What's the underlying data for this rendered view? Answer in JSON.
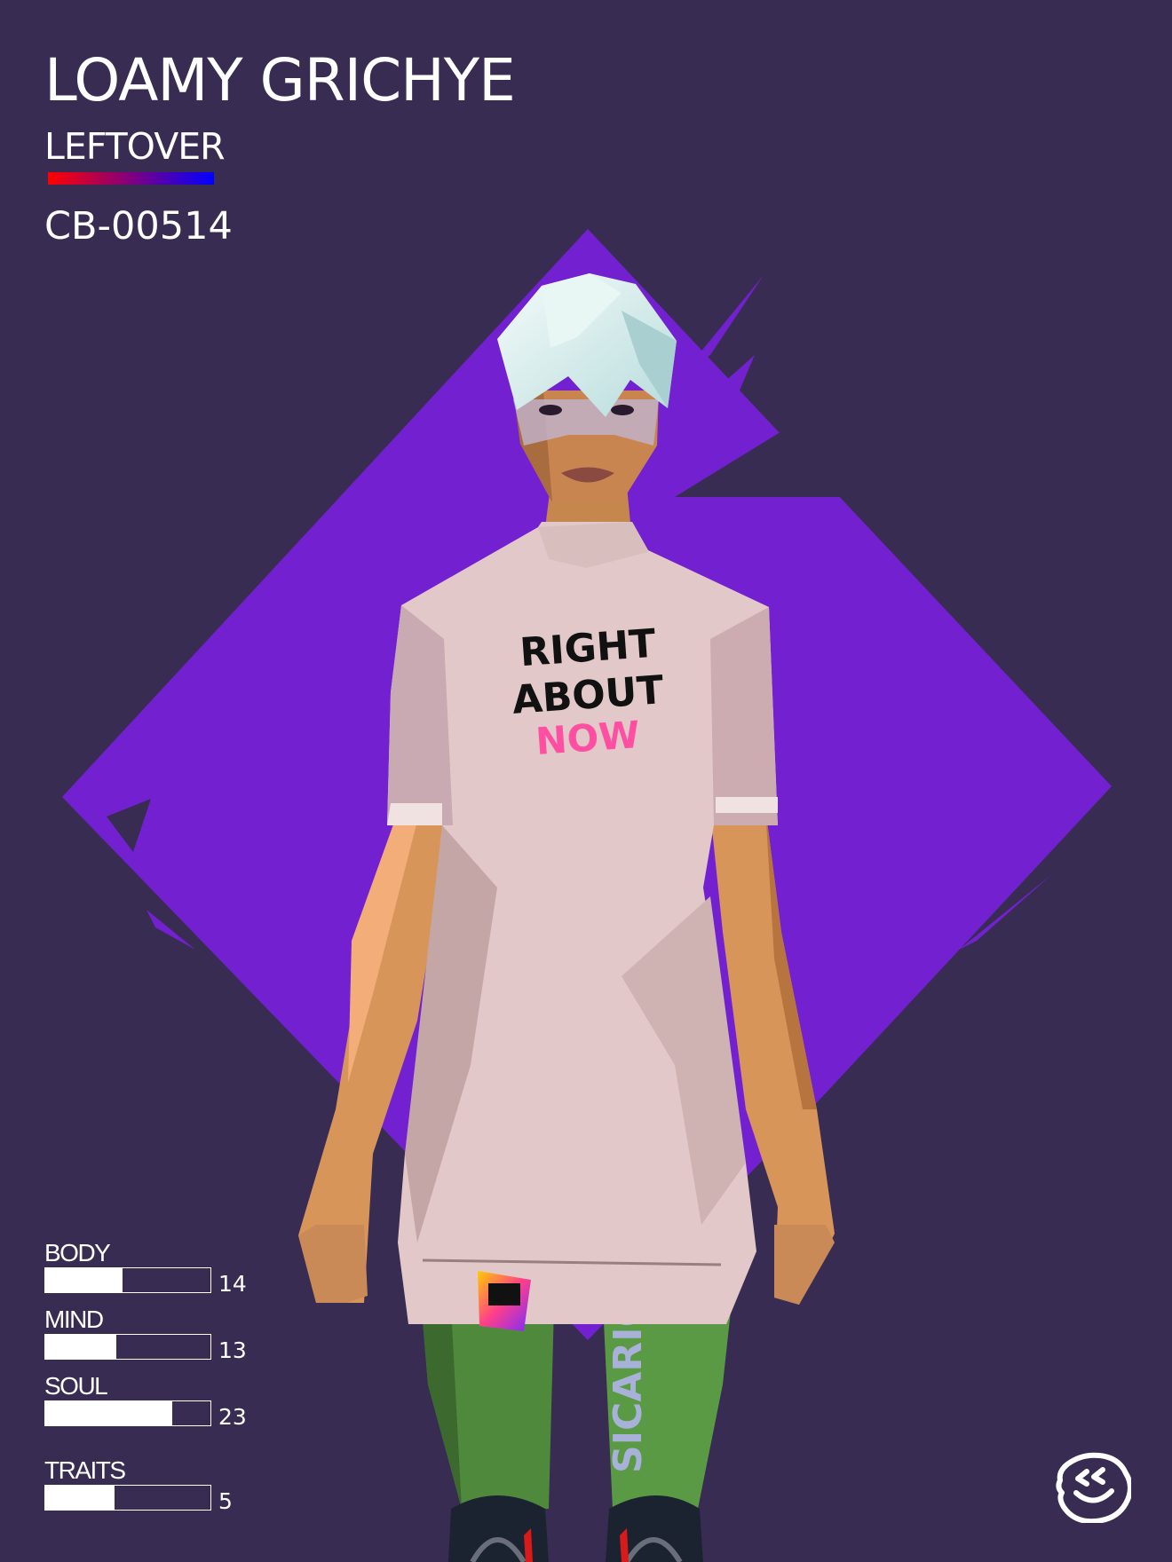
{
  "card": {
    "name": "LOAMY GRICHYE",
    "class": "LEFTOVER",
    "serial": "CB-00514",
    "class_gradient": [
      "#ff0000",
      "#0000ff"
    ]
  },
  "artwork": {
    "shirt_lines": [
      "RIGHT",
      "ABOUT",
      "NOW"
    ],
    "pants_text": "SICARIO",
    "colors": {
      "background": "#382c52",
      "diamond": "#7321d0",
      "shirt": "#e2c8c8",
      "pants": "#4f8a3c",
      "hair": "#d8ecee",
      "skin": "#d8955a",
      "shirt_accent": "#ff4fa2"
    }
  },
  "stats": [
    {
      "label": "BODY",
      "value": "14",
      "fill": 0.47
    },
    {
      "label": "MIND",
      "value": "13",
      "fill": 0.43
    },
    {
      "label": "SOUL",
      "value": "23",
      "fill": 0.77
    },
    {
      "label": "TRAITS",
      "value": "5",
      "fill": 0.42
    }
  ],
  "logo": {
    "icon": "smiley-face-icon"
  }
}
